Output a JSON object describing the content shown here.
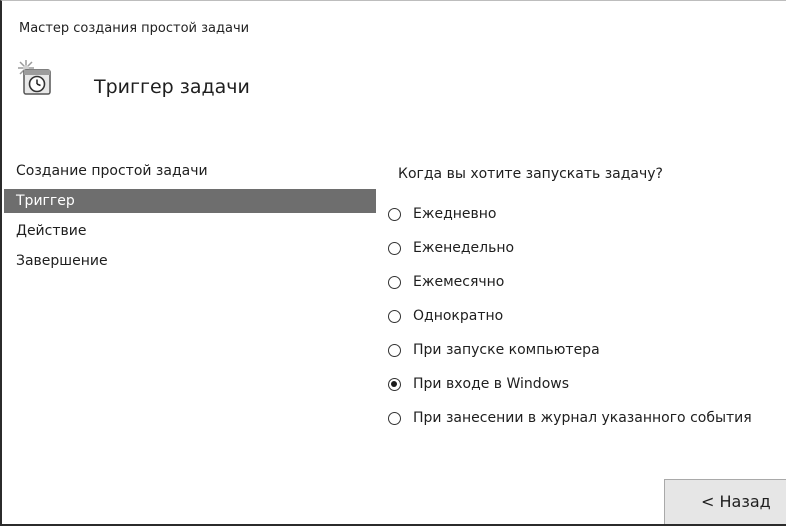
{
  "window": {
    "title": "Мастер создания простой задачи"
  },
  "header": {
    "icon": "scheduled-task-clock-icon",
    "title": "Триггер задачи"
  },
  "sidebar": {
    "items": [
      {
        "label": "Создание простой задачи",
        "active": false
      },
      {
        "label": "Триггер",
        "active": true
      },
      {
        "label": "Действие",
        "active": false
      },
      {
        "label": "Завершение",
        "active": false
      }
    ]
  },
  "main": {
    "question": "Когда вы хотите запускать задачу?",
    "options": [
      {
        "label": "Ежедневно",
        "checked": false
      },
      {
        "label": "Еженедельно",
        "checked": false
      },
      {
        "label": "Ежемесячно",
        "checked": false
      },
      {
        "label": "Однократно",
        "checked": false
      },
      {
        "label": "При запуске компьютера",
        "checked": false
      },
      {
        "label": "При входе в Windows",
        "checked": true
      },
      {
        "label": "При занесении в журнал указанного события",
        "checked": false
      }
    ]
  },
  "footer": {
    "back_label": "< Назад"
  }
}
